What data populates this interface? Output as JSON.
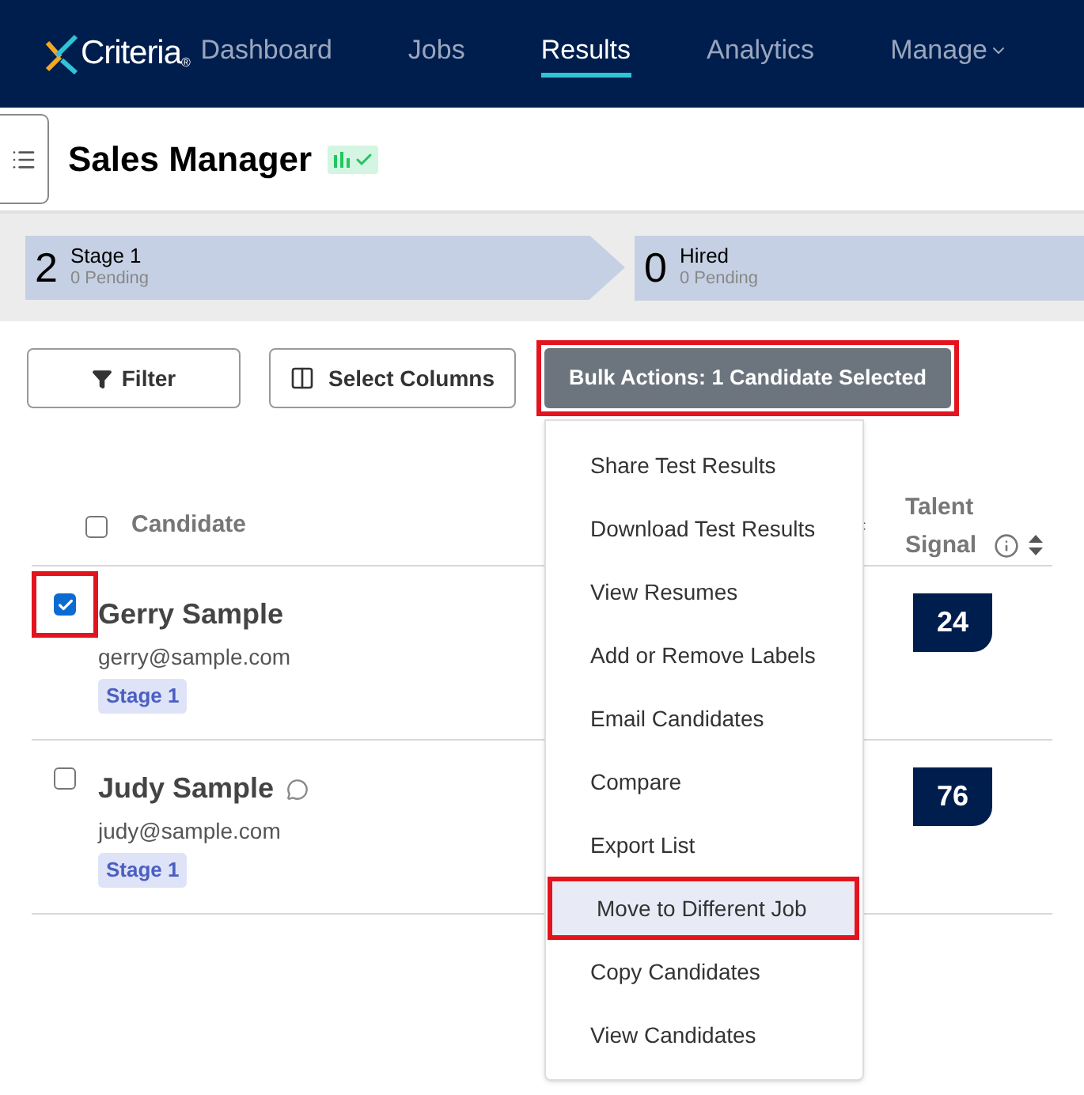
{
  "nav": {
    "logo": "Criteria",
    "logo_mark": "®",
    "items": [
      {
        "label": "Dashboard",
        "selected": false
      },
      {
        "label": "Jobs",
        "selected": false
      },
      {
        "label": "Results",
        "selected": true
      },
      {
        "label": "Analytics",
        "selected": false
      },
      {
        "label": "Manage",
        "selected": false
      }
    ]
  },
  "job": {
    "title": "Sales Manager"
  },
  "stages": [
    {
      "count": "2",
      "name": "Stage 1",
      "pending": "0 Pending"
    },
    {
      "count": "0",
      "name": "Hired",
      "pending": "0 Pending"
    }
  ],
  "toolbar": {
    "filter": "Filter",
    "select_columns": "Select Columns",
    "bulk_actions": {
      "label": "Bulk Actions: 1 Candidate Selected",
      "highlighted": true
    }
  },
  "bulk_menu": [
    {
      "label": "Share Test Results",
      "selected": false,
      "highlighted": false
    },
    {
      "label": "Download Test Results",
      "selected": false,
      "highlighted": false
    },
    {
      "label": "View Resumes",
      "selected": false,
      "highlighted": false
    },
    {
      "label": "Add or Remove Labels",
      "selected": false,
      "highlighted": false
    },
    {
      "label": "Email Candidates",
      "selected": false,
      "highlighted": false
    },
    {
      "label": "Compare",
      "selected": false,
      "highlighted": false
    },
    {
      "label": "Export List",
      "selected": false,
      "highlighted": false
    },
    {
      "label": "Move to Different Job",
      "selected": true,
      "highlighted": true
    },
    {
      "label": "Copy Candidates",
      "selected": false,
      "highlighted": false
    },
    {
      "label": "View Candidates",
      "selected": false,
      "highlighted": false
    }
  ],
  "table": {
    "select_all_checked": false,
    "columns": [
      "Candidate",
      "Talent Signal"
    ],
    "rows": [
      {
        "name": "Gerry Sample",
        "email": "gerry@sample.com",
        "stage": "Stage 1",
        "score": "24",
        "checked": true,
        "highlighted": true,
        "has_comment": false
      },
      {
        "name": "Judy Sample",
        "email": "judy@sample.com",
        "stage": "Stage 1",
        "score": "76",
        "checked": false,
        "highlighted": false,
        "has_comment": true
      }
    ]
  }
}
